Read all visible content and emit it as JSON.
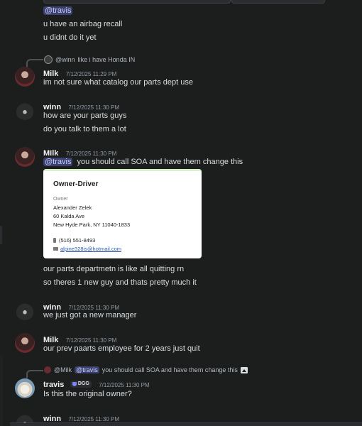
{
  "messages": {
    "m0": {
      "mention": "@travis",
      "line1": "u have an airbag recall",
      "line2": "u didnt do it yet"
    },
    "m1": {
      "reply_user": "@winn",
      "reply_text": "like i have Honda IN",
      "author": "Milk",
      "time": "7/12/2025 11:29 PM",
      "line1": "im not sure what catalog our parts dept use"
    },
    "m2": {
      "author": "winn",
      "time": "7/12/2025 11:30 PM",
      "line1": "how are your parts guys",
      "line2": "do you talk to them a lot"
    },
    "m3": {
      "author": "Milk",
      "time": "7/12/2025 11:30 PM",
      "mention": "@travis",
      "line1": "you should call SOA and have them change this",
      "line2": "our parts departmetn is like all quitting rn",
      "line3": "so theres 1 new guy and thats pretty much it"
    },
    "m4": {
      "author": "winn",
      "time": "7/12/2025 11:30 PM",
      "line1": "we just got a new manager"
    },
    "m5": {
      "author": "Milk",
      "time": "7/12/2025 11:30 PM",
      "line1": "our prev paarts employee for 2 years just quit"
    },
    "m6": {
      "reply_user": "@Milk",
      "reply_mention": "@travis",
      "reply_text": "you should call SOA and have them change this",
      "author": "travis",
      "badge": "DGG",
      "time": "7/12/2025 11:30 PM",
      "line1": "Is this the original owner?"
    },
    "m7": {
      "author": "winn",
      "time": "7/12/2025 11:30 PM"
    }
  },
  "card": {
    "title": "Owner-Driver",
    "label": "Owner",
    "name": "Alexander Zelek",
    "street": "60 Kalda Ave",
    "city": "New Hyde Park, NY 11040-1833",
    "phone": "(516) 551-8493",
    "email": "alpine328is@hotmail.com"
  },
  "colors": {
    "background": "#1b1e1d",
    "mention_bg": "#3c4270",
    "mention_fg": "#c9cdfb",
    "card_accent": "#d8f1c8"
  },
  "icons": [
    "image-icon",
    "phone-icon",
    "mail-icon",
    "shield-badge-icon"
  ]
}
